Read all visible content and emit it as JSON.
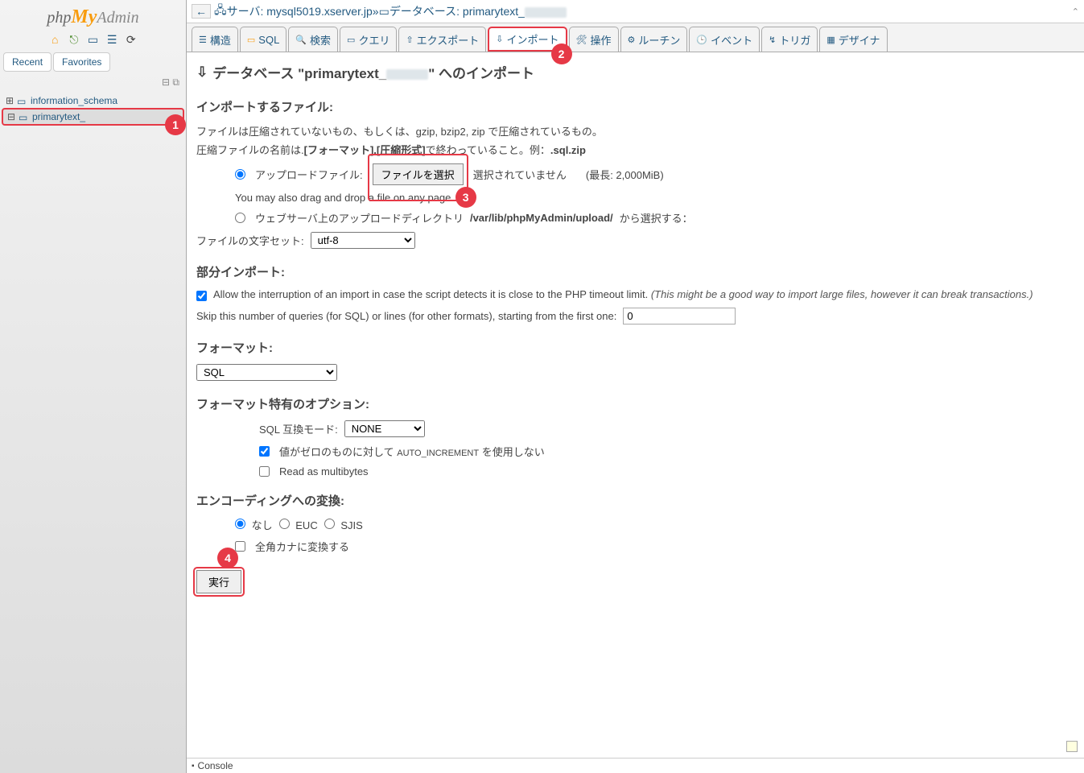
{
  "logo": {
    "php": "php",
    "my": "My",
    "admin": "Admin"
  },
  "sidebar_tabs": {
    "recent": "Recent",
    "favorites": "Favorites"
  },
  "tree": {
    "db1": "information_schema",
    "db2": "primarytext_"
  },
  "breadcrumb": {
    "server_lbl": "サーバ: ",
    "server": "mysql5019.xserver.jp",
    "sep": " » ",
    "db_lbl": "データベース: ",
    "db": "primarytext_"
  },
  "tabs": {
    "structure": "構造",
    "sql": "SQL",
    "search": "検索",
    "query": "クエリ",
    "export": "エクスポート",
    "import": "インポート",
    "operations": "操作",
    "routines": "ルーチン",
    "events": "イベント",
    "triggers": "トリガ",
    "designer": "デザイナ"
  },
  "page_title_pre": "データベース \"primarytext_",
  "page_title_post": "\" へのインポート",
  "sec_import_file": "インポートするファイル:",
  "help1": "ファイルは圧縮されていないもの、もしくは、gzip, bzip2, zip で圧縮されているもの。",
  "help2a": "圧縮ファイルの名前は.",
  "help2b": "[フォーマット].[圧縮形式]",
  "help2c": "で終わっていること。例：",
  "help2d": ".sql.zip",
  "upload_lbl": "アップロードファイル:",
  "file_btn": "ファイルを選択",
  "file_none": "選択されていません",
  "file_max": "(最長: 2,000MiB)",
  "dragdrop": "You may also drag and drop a file on any page.",
  "webdir_lbl": "ウェブサーバ上のアップロードディレクトリ ",
  "webdir_path": "/var/lib/phpMyAdmin/upload/",
  "webdir_post": " から選択する：",
  "charset_lbl": "ファイルの文字セット:",
  "charset_val": "utf-8",
  "sec_partial": "部分インポート:",
  "allow_int": "Allow the interruption of an import in case the script detects it is close to the PHP timeout limit. ",
  "allow_int_note": "(This might be a good way to import large files, however it can break transactions.)",
  "skip_lbl": "Skip this number of queries (for SQL) or lines (for other formats), starting from the first one:",
  "skip_val": "0",
  "sec_format": "フォーマット:",
  "format_val": "SQL",
  "sec_format_opts": "フォーマット特有のオプション:",
  "sql_compat_lbl": "SQL 互換モード:",
  "sql_compat_val": "NONE",
  "autoinc_lbl_pre": "値がゼロのものに対して ",
  "autoinc_code": "AUTO_INCREMENT",
  "autoinc_lbl_post": " を使用しない",
  "read_multi": "Read as multibytes",
  "sec_enc": "エンコーディングへの変換:",
  "enc_none": "なし",
  "enc_euc": "EUC",
  "enc_sjis": "SJIS",
  "zenkaku": "全角カナに変換する",
  "submit": "実行",
  "console": "Console",
  "badges": {
    "1": "1",
    "2": "2",
    "3": "3",
    "4": "4"
  }
}
